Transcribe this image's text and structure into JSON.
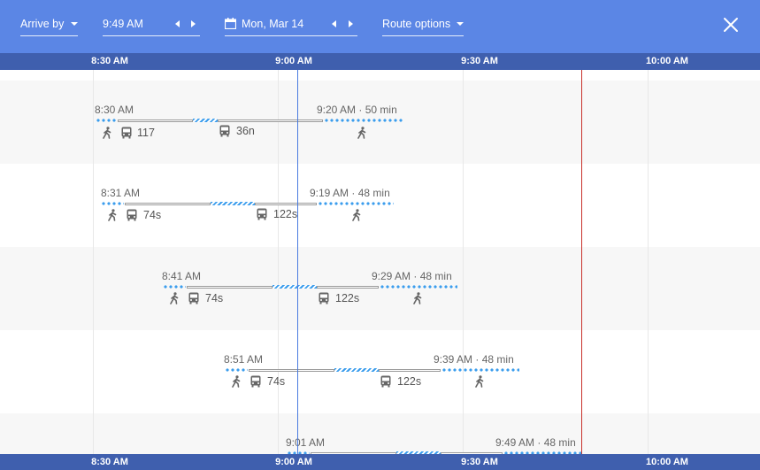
{
  "toolbar": {
    "arrive_mode": "Arrive by",
    "time": "9:49 AM",
    "date": "Mon, Mar 14",
    "route_options": "Route options"
  },
  "axis": {
    "ticks": [
      "8:30 AM",
      "9:00 AM",
      "9:30 AM",
      "10:00 AM"
    ]
  },
  "routes": [
    {
      "depart": "8:30 AM",
      "arrive": "9:20 AM",
      "duration": "50 min",
      "legs": [
        "117",
        "36n"
      ]
    },
    {
      "depart": "8:31 AM",
      "arrive": "9:19 AM",
      "duration": "48 min",
      "legs": [
        "74s",
        "122s"
      ]
    },
    {
      "depart": "8:41 AM",
      "arrive": "9:29 AM",
      "duration": "48 min",
      "legs": [
        "74s",
        "122s"
      ]
    },
    {
      "depart": "8:51 AM",
      "arrive": "9:39 AM",
      "duration": "48 min",
      "legs": [
        "74s",
        "122s"
      ]
    },
    {
      "depart": "9:01 AM",
      "arrive": "9:49 AM",
      "duration": "48 min",
      "legs": []
    }
  ],
  "separator": "·",
  "colors": {
    "toolbar": "#5b86e5",
    "axis_bar": "#3f5fae",
    "walk": "#3b9ded",
    "now_marker": "#4a7be0",
    "arrive_marker": "#c8312a"
  }
}
